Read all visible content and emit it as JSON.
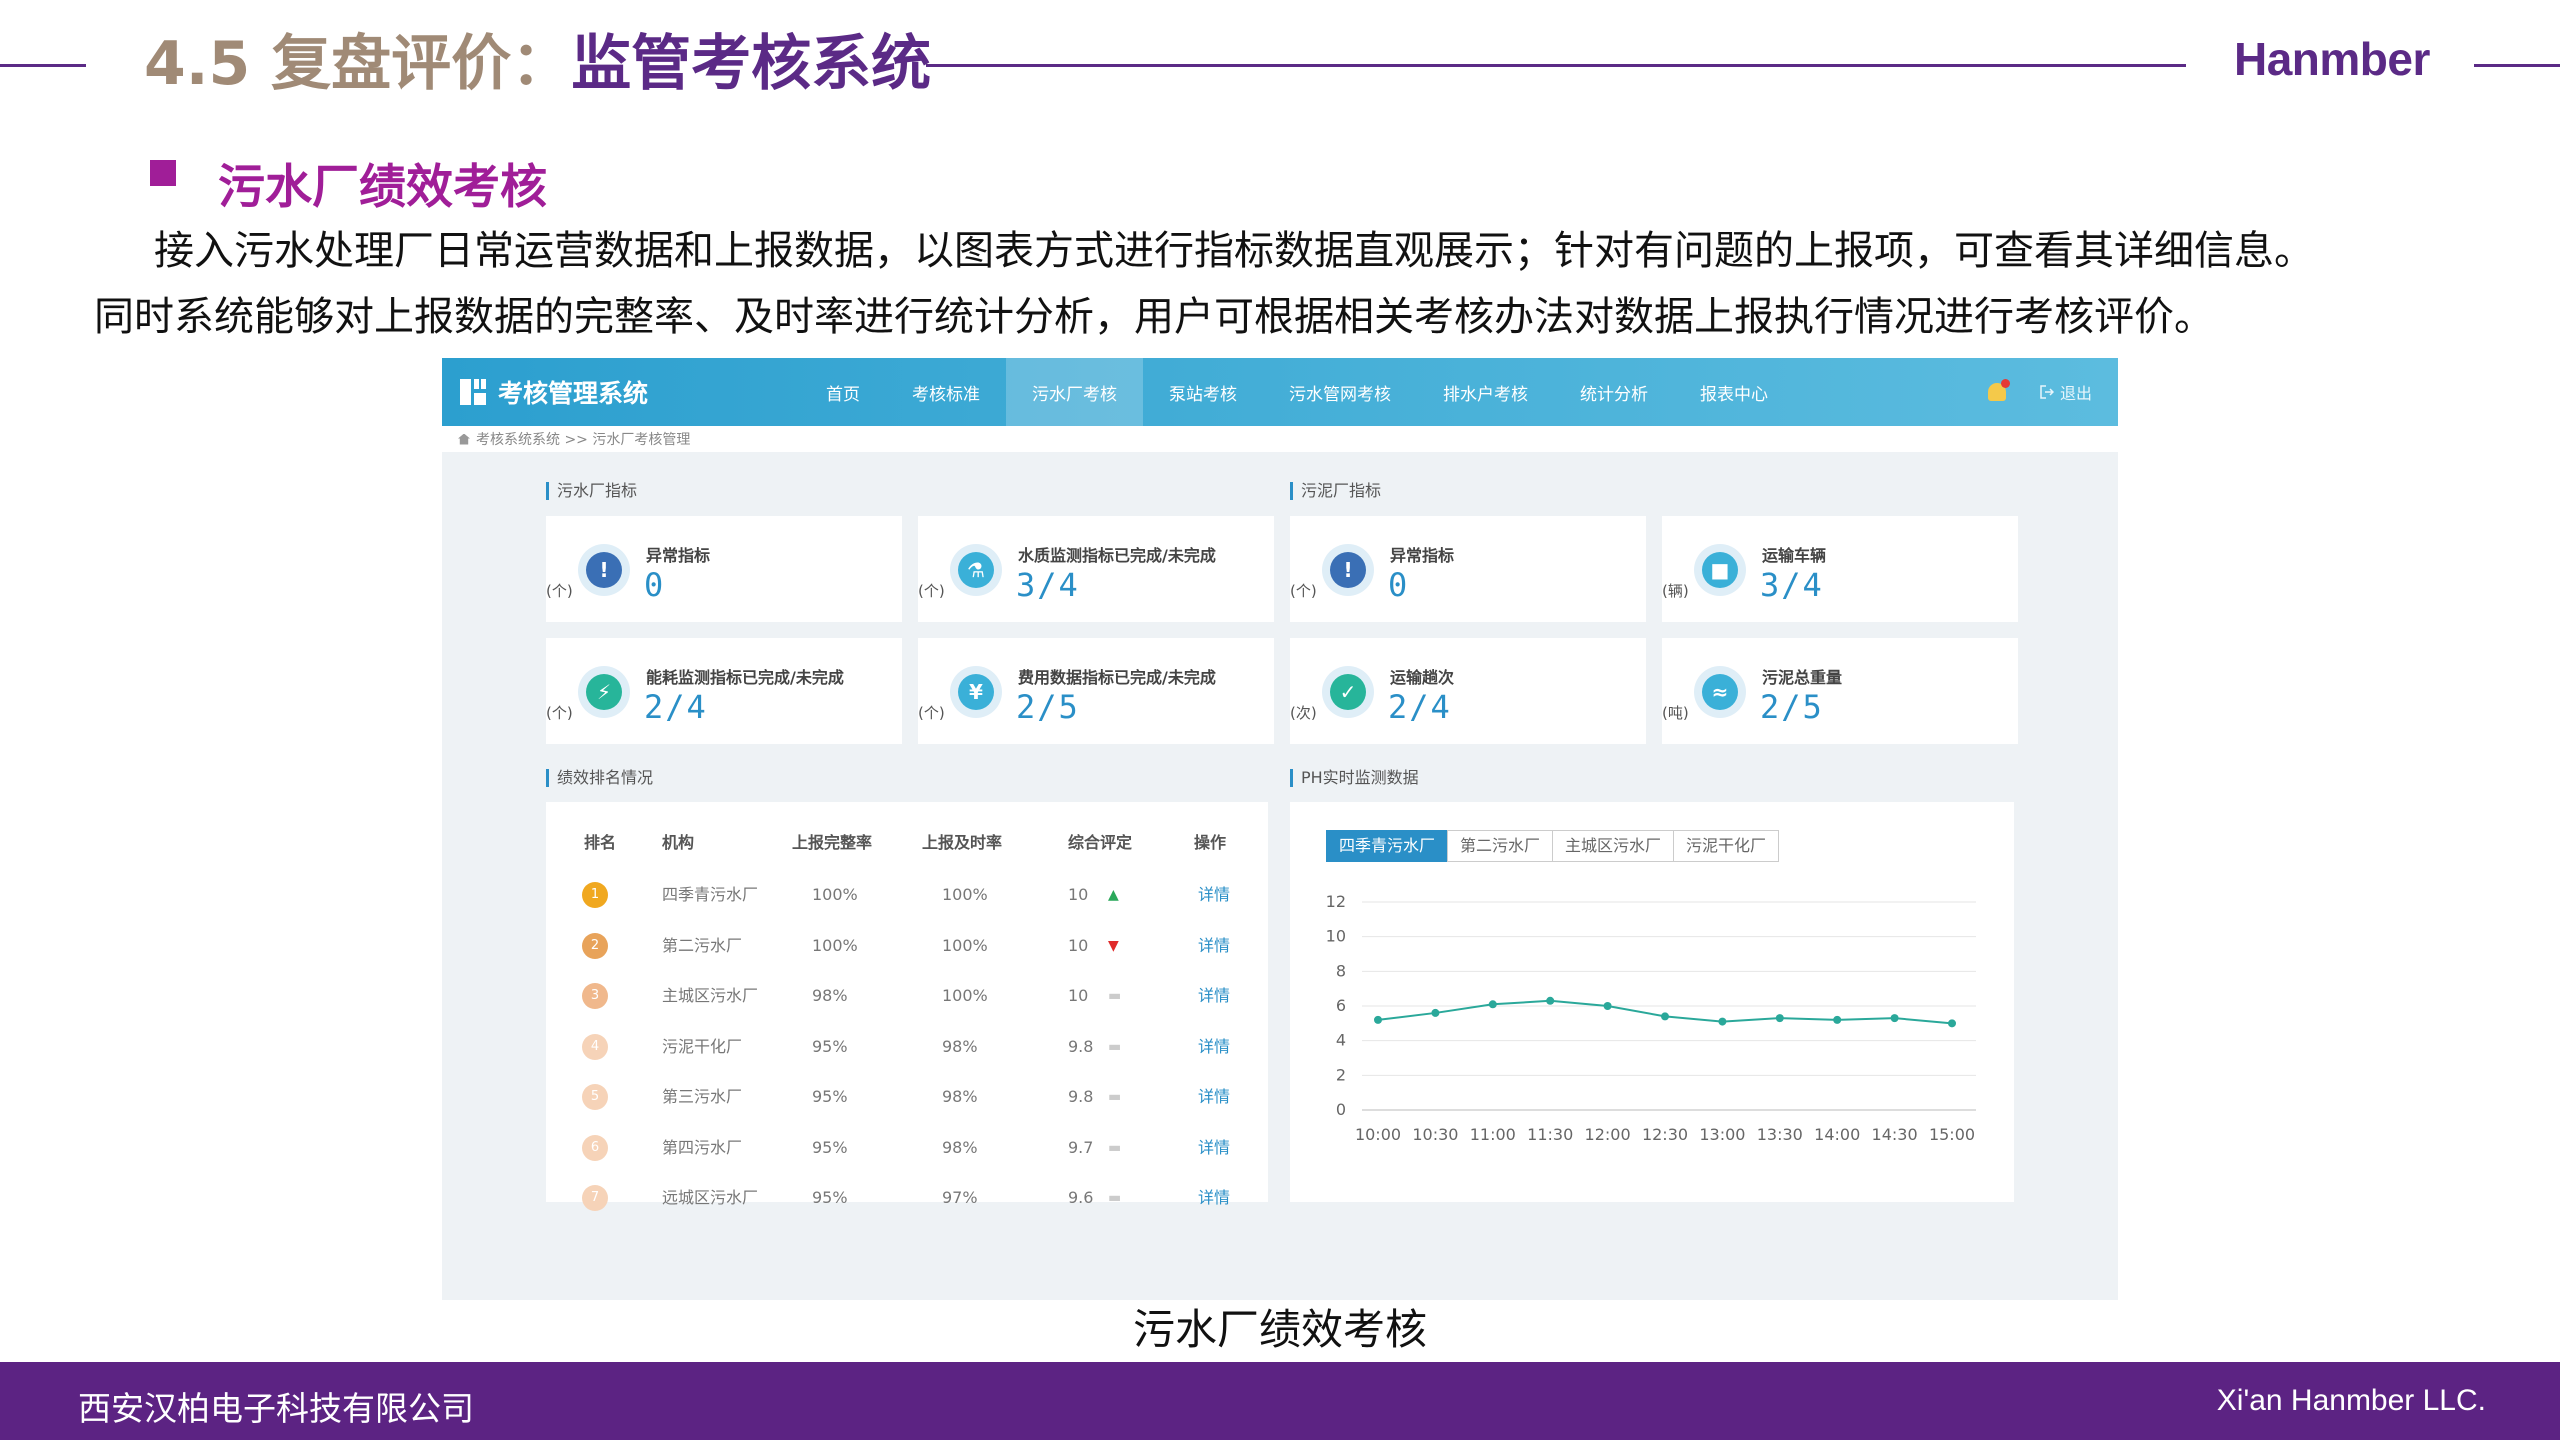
{
  "slide": {
    "title_num": "4.5 复盘评价：",
    "title_main": "监管考核系统",
    "logo": "Hanmber",
    "section_title": "污水厂绩效考核",
    "desc_line1": "接入污水处理厂日常运营数据和上报数据，以图表方式进行指标数据直观展示；针对有问题的上报项，可查看其详细信息。",
    "desc_line2": "同时系统能够对上报数据的完整率、及时率进行统计分析，用户可根据相关考核办法对数据上报执行情况进行考核评价。",
    "caption": "污水厂绩效考核",
    "footer_left": "西安汉柏电子科技有限公司",
    "footer_right": "Xi'an Hanmber LLC."
  },
  "app": {
    "brand": "考核管理系统",
    "nav": [
      "首页",
      "考核标准",
      "污水厂考核",
      "泵站考核",
      "污水管网考核",
      "排水户考核",
      "统计分析",
      "报表中心"
    ],
    "active_nav_index": 2,
    "logout": "退出",
    "breadcrumb": "考核系统系统 >> 污水厂考核管理",
    "colors": {
      "accent": "#2a8fc7",
      "nav": "#3aa9d6"
    }
  },
  "wwtp_group": {
    "title": "污水厂指标",
    "cards": [
      {
        "label": "异常指标",
        "value": "0",
        "unit": "(个)",
        "icon": "warning-icon",
        "color": "#3a6fb5"
      },
      {
        "label": "水质监测指标已完成/未完成",
        "value": "3/4",
        "unit": "(个)",
        "icon": "flask-icon",
        "color": "#3ab0d8"
      },
      {
        "label": "能耗监测指标已完成/未完成",
        "value": "2/4",
        "unit": "(个)",
        "icon": "drop-energy-icon",
        "color": "#27b59a"
      },
      {
        "label": "费用数据指标已完成/未完成",
        "value": "2/5",
        "unit": "(个)",
        "icon": "money-bag-icon",
        "color": "#3ab0d8"
      }
    ]
  },
  "sludge_group": {
    "title": "污泥厂指标",
    "cards": [
      {
        "label": "异常指标",
        "value": "0",
        "unit": "(个)",
        "icon": "warning-icon",
        "color": "#3a6fb5"
      },
      {
        "label": "运输车辆",
        "value": "3/4",
        "unit": "(辆)",
        "icon": "truck-icon",
        "color": "#3ab0d8"
      },
      {
        "label": "运输趟次",
        "value": "2/4",
        "unit": "(次)",
        "icon": "delivery-icon",
        "color": "#27b59a"
      },
      {
        "label": "污泥总重量",
        "value": "2/5",
        "unit": "(吨)",
        "icon": "sludge-weight-icon",
        "color": "#3ab0d8"
      }
    ]
  },
  "ranking": {
    "title": "绩效排名情况",
    "headers": [
      "排名",
      "机构",
      "上报完整率",
      "上报及时率",
      "综合评定",
      "操作"
    ],
    "rows": [
      {
        "rank": "1",
        "org": "四季青污水厂",
        "complete": "100%",
        "timely": "100%",
        "score": "10",
        "trend": "up",
        "action": "详情",
        "badge": "#f0a820"
      },
      {
        "rank": "2",
        "org": "第二污水厂",
        "complete": "100%",
        "timely": "100%",
        "score": "10",
        "trend": "down",
        "action": "详情",
        "badge": "#e8a35a"
      },
      {
        "rank": "3",
        "org": "主城区污水厂",
        "complete": "98%",
        "timely": "100%",
        "score": "10",
        "trend": "flat",
        "action": "详情",
        "badge": "#f0b88c"
      },
      {
        "rank": "4",
        "org": "污泥干化厂",
        "complete": "95%",
        "timely": "98%",
        "score": "9.8",
        "trend": "flat",
        "action": "详情",
        "badge": "#f6d3b8"
      },
      {
        "rank": "5",
        "org": "第三污水厂",
        "complete": "95%",
        "timely": "98%",
        "score": "9.8",
        "trend": "flat",
        "action": "详情",
        "badge": "#f6d3b8"
      },
      {
        "rank": "6",
        "org": "第四污水厂",
        "complete": "95%",
        "timely": "98%",
        "score": "9.7",
        "trend": "flat",
        "action": "详情",
        "badge": "#f6d3b8"
      },
      {
        "rank": "7",
        "org": "远城区污水厂",
        "complete": "95%",
        "timely": "97%",
        "score": "9.6",
        "trend": "flat",
        "action": "详情",
        "badge": "#f6d3b8"
      }
    ]
  },
  "ph_panel": {
    "title": "PH实时监测数据",
    "tabs": [
      "四季青污水厂",
      "第二污水厂",
      "主城区污水厂",
      "污泥干化厂"
    ],
    "active_tab_index": 0
  },
  "chart_data": {
    "type": "line",
    "categories": [
      "10:00",
      "10:30",
      "11:00",
      "11:30",
      "12:00",
      "12:30",
      "13:00",
      "13:30",
      "14:00",
      "14:30",
      "15:00"
    ],
    "values": [
      5.2,
      5.6,
      6.1,
      6.3,
      6.0,
      5.4,
      5.1,
      5.3,
      5.2,
      5.3,
      5.0
    ],
    "yticks": [
      0,
      2,
      4,
      6,
      8,
      10,
      12
    ],
    "ylim": [
      0,
      12
    ],
    "line_color": "#2aa89a",
    "grid": true
  }
}
